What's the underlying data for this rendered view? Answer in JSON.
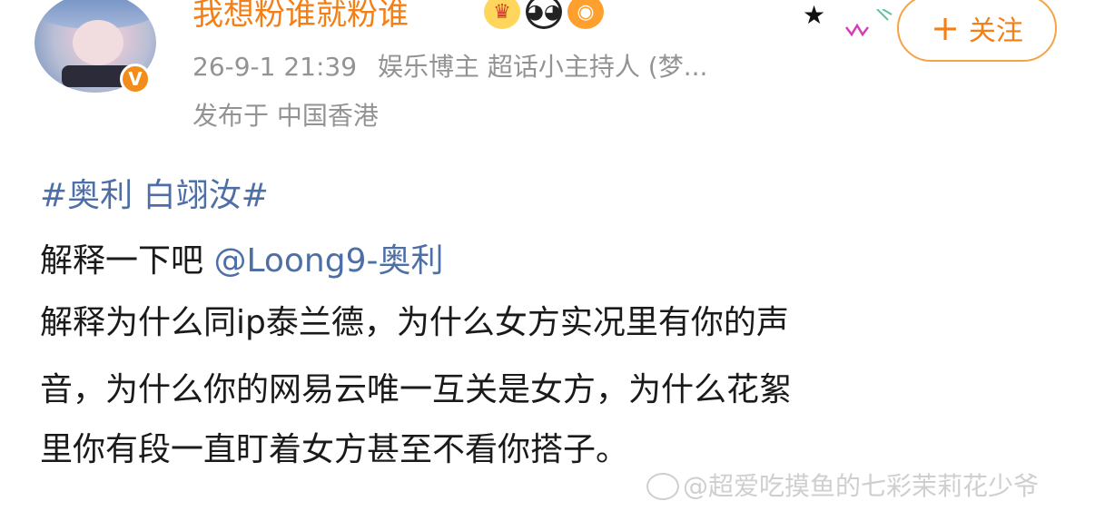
{
  "post": {
    "username": "我想粉谁就粉谁",
    "verified_badge": "V",
    "emojis": [
      {
        "name": "crown-emoji",
        "glyph": "♛"
      },
      {
        "name": "panda-emoji",
        "glyph": "◕◕"
      },
      {
        "name": "fish-emoji",
        "glyph": "◉"
      }
    ],
    "follow_button_plus": "+",
    "follow_button_label": "关注",
    "timestamp": "26-9-1 21:39",
    "tags_text": "娱乐博主 超话小主持人 (梦...",
    "location": "发布于 中国香港",
    "topic": "#奥利 白翊汝#",
    "body_line1_text": "解释一下吧 ",
    "mention": "@Loong9-奥利",
    "body_line2": "解释为什么同ip泰兰德，为什么女方实况里有你的声",
    "body_line3": "音，为什么你的网易云唯一互关是女方，为什么花絮",
    "body_line4": "里你有段一直盯着女方甚至不看你搭子。",
    "watermark": "@超爱吃摸鱼的七彩茉莉花少爷"
  },
  "colors": {
    "username": "#f37f16",
    "link": "#4d6fa6",
    "meta": "#939393",
    "text": "#1a1a1a",
    "verified": "#f28c1a"
  }
}
